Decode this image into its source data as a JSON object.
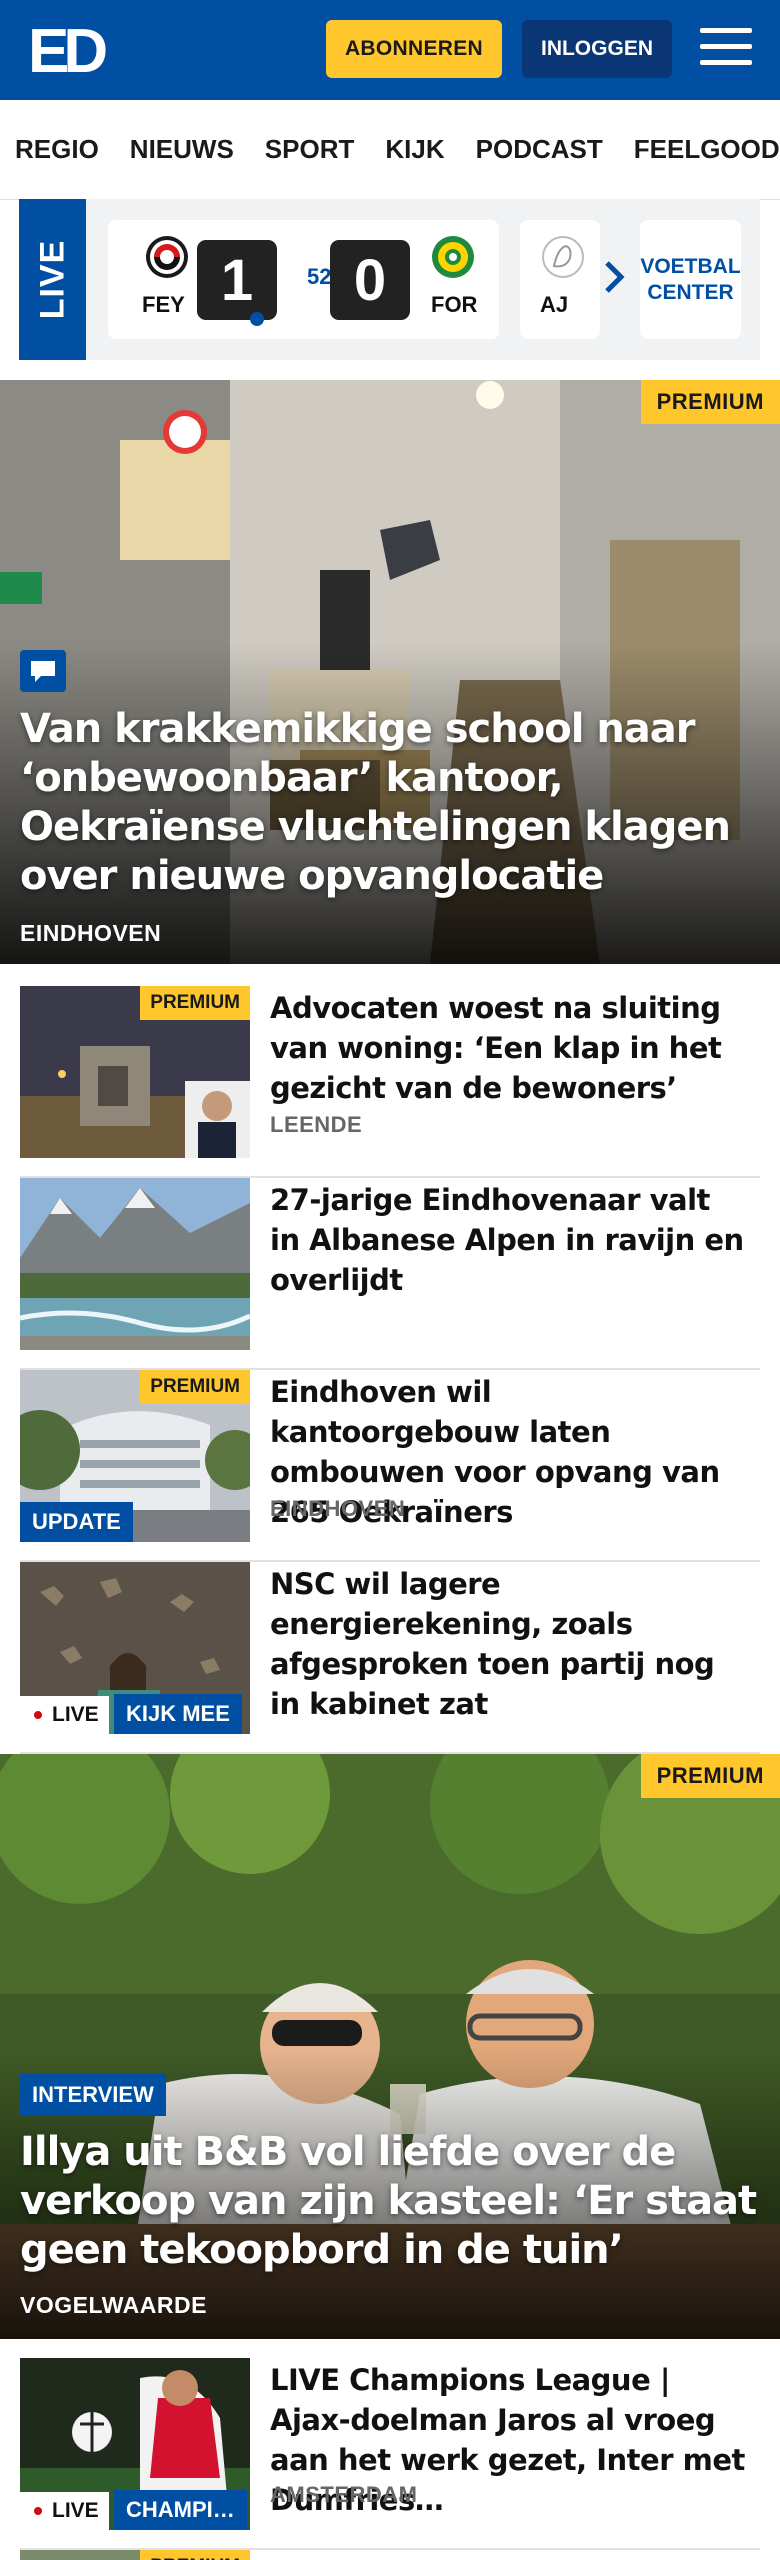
{
  "header": {
    "logo_text": "ED",
    "subscribe_label": "ABONNEREN",
    "login_label": "INLOGGEN",
    "menu_icon": "hamburger-menu-icon",
    "brand_color": "#004fa3",
    "accent_color": "#ffc72c"
  },
  "nav": {
    "items": [
      "REGIO",
      "NIEUWS",
      "SPORT",
      "KIJK",
      "PODCAST",
      "FEELGOOD"
    ]
  },
  "live_scores": {
    "badge": "LIVE",
    "match": {
      "home_code": "FEY",
      "home_score": "1",
      "minute": "52'",
      "away_score": "0",
      "away_code": "FOR"
    },
    "next_match_code": "AJ",
    "voetbal_center_label": "VOETBAL CENTER"
  },
  "hero1": {
    "premium": "PREMIUM",
    "title": "Van krakkemikkige school naar ‘onbewoonbaar’ kantoor, Oekraïense vluchtelingen klagen over nieuwe opvanglocatie",
    "location": "EINDHOVEN"
  },
  "articles": [
    {
      "title": "Advocaten woest na sluiting van woning: ‘Een klap in het gezicht van de bewoners’",
      "location": "LEENDE",
      "premium": "PREMIUM"
    },
    {
      "title": "27-jarige Eindhovenaar valt in Albanese Alpen in ravijn en overlijdt",
      "location": ""
    },
    {
      "title": "Eindhoven wil kantoorgebouw laten ombouwen voor opvang van 265 Oekraïners",
      "location": "EINDHOVEN",
      "premium": "PREMIUM",
      "tag": "UPDATE"
    },
    {
      "title": "NSC wil lagere energierekening, zoals afgesproken toen partij nog in kabinet zat",
      "location": "",
      "live": "LIVE",
      "tag": "KIJK MEE"
    }
  ],
  "hero2": {
    "premium": "PREMIUM",
    "tag": "INTERVIEW",
    "title": "Illya uit B&B vol liefde over de verkoop van zijn kasteel: ‘Er staat geen tekoopbord in de tuin’",
    "location": "VOGELWAARDE"
  },
  "article_cl": {
    "title": "LIVE Champions League | Ajax-doelman Jaros al vroeg aan het werk gezet, Inter met Dumfries…",
    "location": "AMSTERDAM",
    "live": "LIVE",
    "tag": "CHAMPI…"
  },
  "article_next": {
    "premium": "PREMIUM"
  }
}
